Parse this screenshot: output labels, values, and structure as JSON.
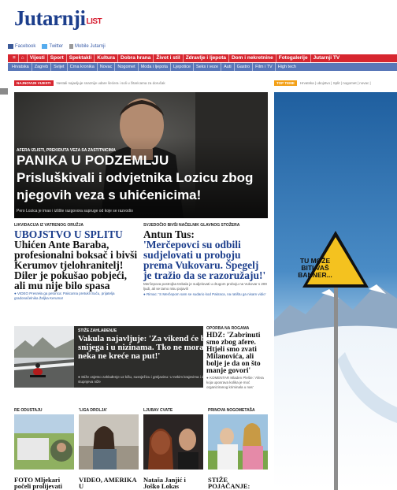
{
  "site": {
    "logo_text": "Jutarnji",
    "logo_suffix": "LIST"
  },
  "social": [
    "Facebook",
    "Twitter",
    "Mobile Jutarnji"
  ],
  "nav_main": [
    "Vijesti",
    "Sport",
    "Spektakli",
    "Kultura",
    "Dobra hrana",
    "Život i stil",
    "Zdravlje i ljepota",
    "Dom i nekretnine",
    "Fotogalerije",
    "Jutarnji TV"
  ],
  "nav_sub": [
    "Hrvatska",
    "Zagreb",
    "Svijet",
    "Crna kronika",
    "Novac",
    "Nogomet",
    "Moda i ljepota",
    "Ljepotice",
    "Seks i veze",
    "Auti",
    "Gastro",
    "Film i TV",
    "High tech"
  ],
  "ticker_left": {
    "badge": "NAJNOVIJE VIJESTI",
    "text": "Nestali najavljuje snaznije udare šećera i soli u žitaricama za doručak"
  },
  "ticker_right": {
    "badge": "TOP TEME",
    "text": "Hrvatska | ubojstvo | Split | nogomet | novac |"
  },
  "hero": {
    "kicker": "AFERA IZLISTI, PREKIDUTA VEZA SA ZASTITNICIMA",
    "title1": "PANIKA U PODZEMLJU",
    "title2": "Prisluškivali i odvjetnika Lozicu zbog njegovih veza s uhićenicima!",
    "caption": "Pero Lozica je imao i izlište razgovora supruge od koje se razvodio"
  },
  "story_left": {
    "kicker": "LIKVIDACIJA IZ VATRENOG ORUŽJA",
    "title_blue": "UBOJSTVO U SPLITU",
    "title": "Uhićen Ante Baraba, profesionalni boksač i bivši Kerumov tjelohranitelj! Diler je pokušao pobjeći, ali mu nije bilo spasa",
    "link": "VIDEO Presreła ga petorica: Pakcarna pretukli Suču, prijatelja gradonačelnika Željka Keruma!"
  },
  "story_right": {
    "kicker": "SVJEDOČIO BIVŠI NAČELNIK GLAVNOG STOŽERA",
    "title_blue": "Antun Tus:",
    "title": "'Merčepovci su odbili sudjelovati u proboju prema Vukovaru. Špegelj je tražio da se razoružaju!'",
    "sub": "Merčepova postrojba trebala je sudjelovati u drugom proboju na Vukovar s 200 ljudi, ali se tamo nisu pojavili",
    "link": "Rimac: 'S Merčepom sam se sudario kod Pakraca, na ratištu ga nisam vidio'"
  },
  "mid_story": {
    "kicker": "STIŽE ZAHLAĐENJE",
    "title": "Vakula najavljuje: 'Za vikend će biti snijega i u nizinama. Tko ne mora, neka ne kreće na put!'",
    "link": "Stiže osjetno zahlađenje uz kišu, susnježicu i gmljavinu: U nekim krajevima i do 10 stupnjeva niže"
  },
  "side_story": {
    "kicker": "OPORBA NA ROGAMA",
    "title": "HDZ: 'Zabrinuti smo zbog afere. Htjeli smo zvati Milanovića, ali bolje je da on što manje govori'",
    "link": "KOMENTAR Mladen Plešie: 'Afera koja uposrava kolika je moć organiziranog kriminala u nas'"
  },
  "thumbs": [
    {
      "kicker": "RE ODUSTAJU",
      "title": "FOTO Mljekari počeli prolijevati"
    },
    {
      "kicker": "'LIGA DROLJA'",
      "title": "VIDEO, AMERIKA U"
    },
    {
      "kicker": "LJUBAV CVATE",
      "title": "Nataša Janjić i Joško Lokas"
    },
    {
      "kicker": "PRINOVA NOGOMETAŠA",
      "title": "STIŽE POJAČANJE:"
    }
  ],
  "ad": {
    "text": "TU MOŽE BITI VAŠ BANNER..."
  },
  "colors": {
    "brand_blue": "#1c3e8c",
    "nav_red": "#d7262f",
    "nav_blue": "#5977b8",
    "ad_sign": "#f4c21f"
  }
}
